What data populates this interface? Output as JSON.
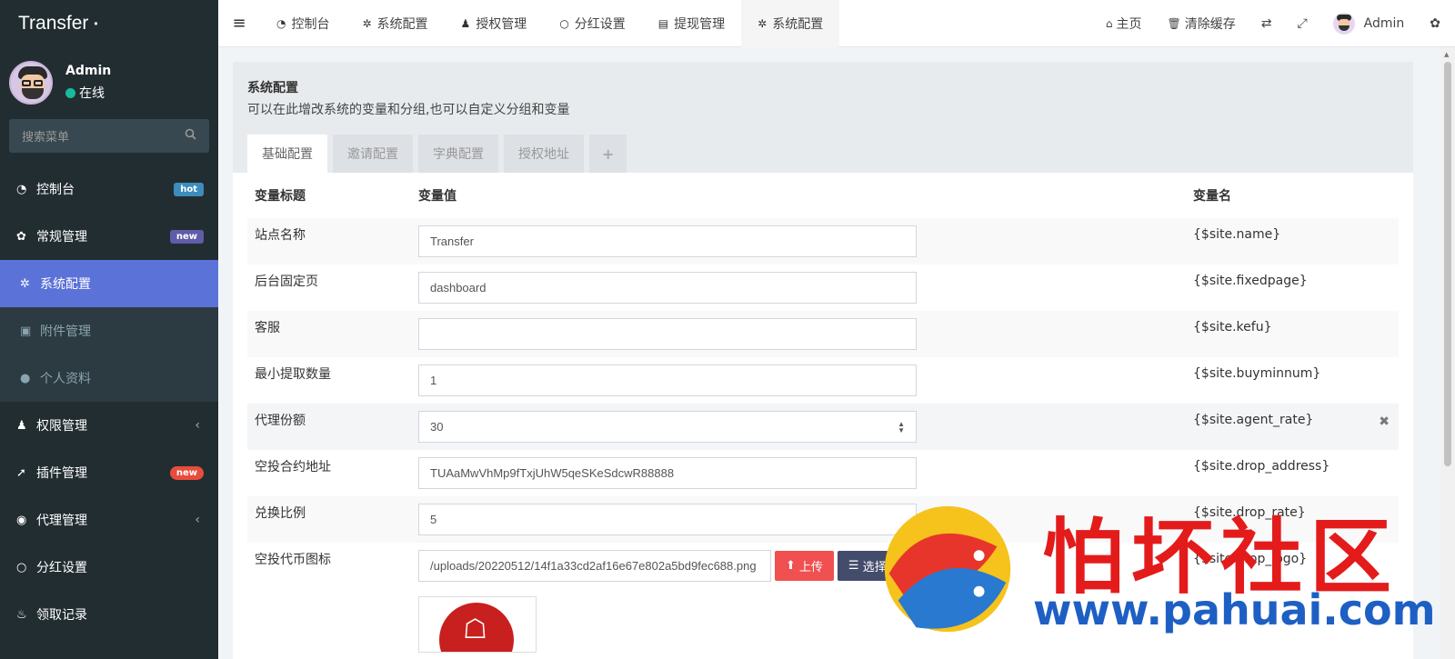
{
  "app": {
    "brand": "Transfer",
    "brand_caret": "•"
  },
  "user": {
    "name": "Admin",
    "status": "在线"
  },
  "sidebar": {
    "search_placeholder": "搜索菜单",
    "items": [
      {
        "label": "控制台",
        "icon": "dashboard-icon",
        "badge": "hot"
      },
      {
        "label": "常规管理",
        "icon": "cogs-icon",
        "badge": "new"
      },
      {
        "label": "系统配置",
        "icon": "gear-icon",
        "active": true
      },
      {
        "label": "附件管理",
        "icon": "image-icon"
      },
      {
        "label": "个人资料",
        "icon": "user-icon"
      },
      {
        "label": "权限管理",
        "icon": "users-icon",
        "arrow": "‹"
      },
      {
        "label": "插件管理",
        "icon": "rocket-icon",
        "badge": "new"
      },
      {
        "label": "代理管理",
        "icon": "user-circle-icon",
        "arrow": "‹"
      },
      {
        "label": "分红设置",
        "icon": "circle-icon"
      },
      {
        "label": "领取记录",
        "icon": "records-icon"
      }
    ]
  },
  "topnav": {
    "tabs": [
      {
        "label": "控制台",
        "icon": "dashboard-icon"
      },
      {
        "label": "系统配置",
        "icon": "gear-icon"
      },
      {
        "label": "授权管理",
        "icon": "users-icon"
      },
      {
        "label": "分红设置",
        "icon": "circle-icon"
      },
      {
        "label": "提现管理",
        "icon": "cc-icon"
      },
      {
        "label": "系统配置",
        "icon": "gear-icon",
        "active": true
      }
    ],
    "right": {
      "home": "主页",
      "clear_cache": "清除缓存",
      "user": "Admin"
    }
  },
  "page": {
    "title": "系统配置",
    "description": "可以在此增改系统的变量和分组,也可以自定义分组和变量",
    "tabs": [
      "基础配置",
      "邀请配置",
      "字典配置",
      "授权地址",
      "+"
    ],
    "table": {
      "headers": [
        "变量标题",
        "变量值",
        "变量名"
      ],
      "rows": [
        {
          "title": "站点名称",
          "value": "Transfer",
          "name": "{$site.name}"
        },
        {
          "title": "后台固定页",
          "value": "dashboard",
          "name": "{$site.fixedpage}"
        },
        {
          "title": "客服",
          "value": "",
          "name": "{$site.kefu}"
        },
        {
          "title": "最小提取数量",
          "value": "1",
          "name": "{$site.buyminnum}"
        },
        {
          "title": "代理份额",
          "value": "30",
          "name": "{$site.agent_rate}"
        },
        {
          "title": "空投合约地址",
          "value": "TUAaMwVhMp9fTxjUhW5qeSKeSdcwR88888",
          "name": "{$site.drop_address}"
        },
        {
          "title": "兑换比例",
          "value": "5",
          "name": "{$site.drop_rate}"
        },
        {
          "title": "空投代币图标",
          "value": "/uploads/20220512/14f1a33cd2af16e67e802a5bd9fec688.png",
          "name": "{$site.drop_logo}"
        }
      ],
      "upload_label": "上传",
      "choose_label": "选择"
    }
  },
  "watermark": {
    "text": "怕坏社区",
    "url": "www.pahuai.com"
  },
  "colors": {
    "sidebar_bg": "#222d32",
    "active": "#5b75d9",
    "upload_btn": "#f05050",
    "choose_btn": "#444c6b"
  }
}
